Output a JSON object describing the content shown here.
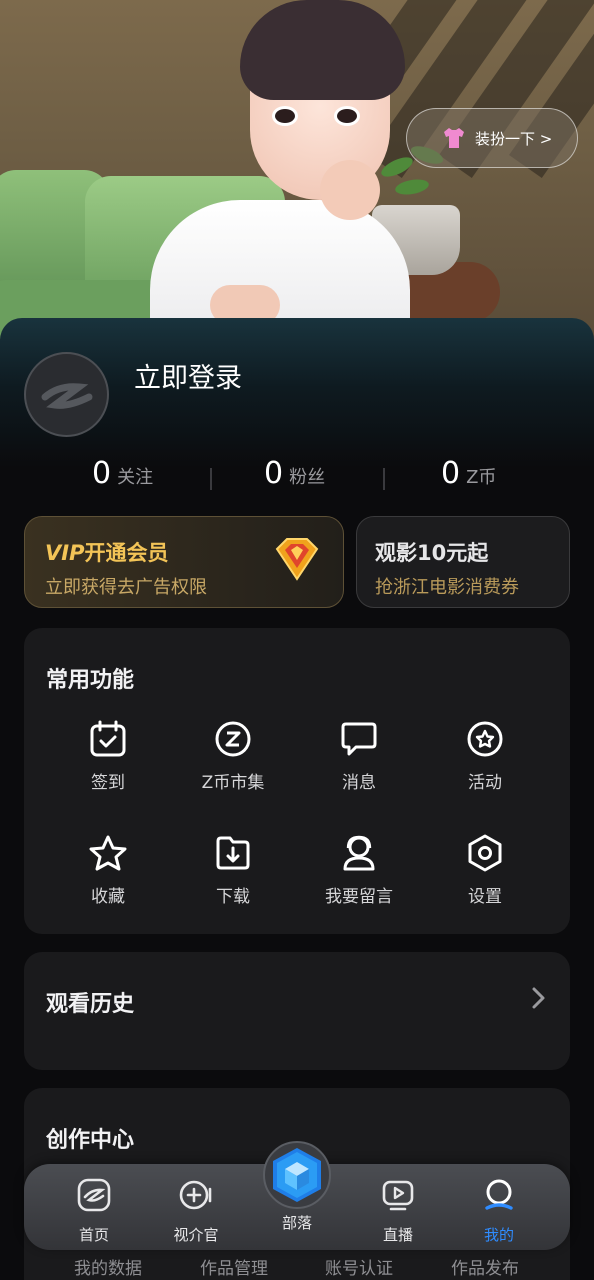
{
  "hero": {
    "dress_up_label": "装扮一下 >",
    "dress_up_icon": "shirt-icon"
  },
  "profile": {
    "login_label": "立即登录",
    "avatar_icon": "z-logo-icon"
  },
  "stats": [
    {
      "num": "0",
      "label": "关注"
    },
    {
      "num": "0",
      "label": "粉丝"
    },
    {
      "num": "0",
      "label": "Z币"
    }
  ],
  "vip": {
    "badge": "VIP",
    "title": "开通会员",
    "subtitle": "立即获得去广告权限",
    "icon": "diamond-icon",
    "accent": "#f3c457"
  },
  "movie": {
    "title": "观影10元起",
    "subtitle": "抢浙江电影消费券"
  },
  "functions": {
    "title": "常用功能",
    "items": [
      {
        "label": "签到",
        "icon": "calendar-check-icon"
      },
      {
        "label": "Z币市集",
        "icon": "z-coin-icon"
      },
      {
        "label": "消息",
        "icon": "message-icon"
      },
      {
        "label": "活动",
        "icon": "star-badge-icon"
      },
      {
        "label": "收藏",
        "icon": "star-icon"
      },
      {
        "label": "下载",
        "icon": "download-icon"
      },
      {
        "label": "我要留言",
        "icon": "support-icon"
      },
      {
        "label": "设置",
        "icon": "settings-icon"
      }
    ]
  },
  "history": {
    "title": "观看历史"
  },
  "creation": {
    "title": "创作中心",
    "items": [
      "我的数据",
      "作品管理",
      "账号认证",
      "作品发布"
    ]
  },
  "nav": {
    "items": [
      {
        "label": "首页",
        "icon": "home-logo-icon",
        "active": false
      },
      {
        "label": "视介官",
        "icon": "video-add-icon",
        "active": false
      },
      {
        "label": "部落",
        "icon": "cube-icon",
        "active": false
      },
      {
        "label": "直播",
        "icon": "live-play-icon",
        "active": false
      },
      {
        "label": "我的",
        "icon": "profile-icon",
        "active": true
      }
    ],
    "active_color": "#2f8cff"
  }
}
